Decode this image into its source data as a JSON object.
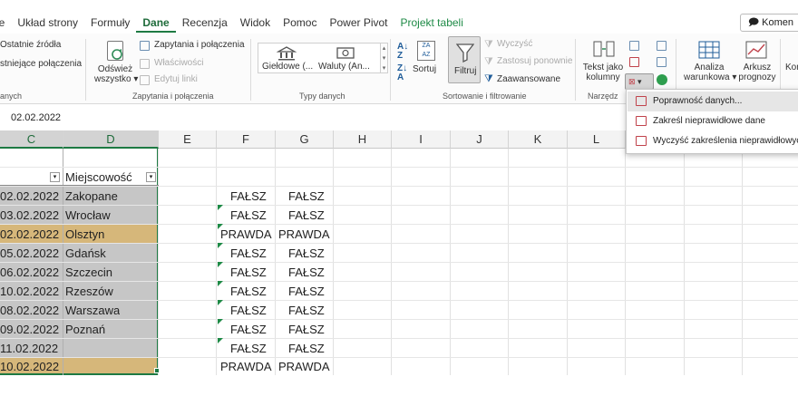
{
  "menu": {
    "tabs": [
      "ie",
      "Układ strony",
      "Formuły",
      "Dane",
      "Recenzja",
      "Widok",
      "Pomoc",
      "Power Pivot",
      "Projekt tabeli"
    ],
    "active": "Dane",
    "comments": "Komen"
  },
  "ribbon": {
    "left": {
      "recent_sources": "Ostatnie źródła",
      "existing_connections": "stniejące połączenia",
      "group_label": "anych"
    },
    "queries": {
      "refresh_all_line1": "Odśwież",
      "refresh_all_line2": "wszystko",
      "queries_connections": "Zapytania i połączenia",
      "properties": "Właściwości",
      "edit_links": "Edytuj linki",
      "group_label": "Zapytania i połączenia"
    },
    "data_types": {
      "stocks": "Giełdowe (...",
      "currencies": "Waluty (An...",
      "group_label": "Typy danych"
    },
    "sort_filter": {
      "sort": "Sortuj",
      "filter": "Filtruj",
      "clear": "Wyczyść",
      "reapply": "Zastosuj ponownie",
      "advanced": "Zaawansowane",
      "group_label": "Sortowanie i filtrowanie"
    },
    "tools": {
      "text_to_columns_line1": "Tekst jako",
      "text_to_columns_line2": "kolumny",
      "group_label": "Narzędz"
    },
    "forecast": {
      "whatif_line1": "Analiza",
      "whatif_line2": "warunkowa",
      "sheet_line1": "Arkusz",
      "sheet_line2": "prognozy",
      "outline": "Kon"
    }
  },
  "formula_bar": {
    "value": "02.02.2022"
  },
  "columns": [
    "C",
    "D",
    "E",
    "F",
    "G",
    "H",
    "I",
    "J",
    "K",
    "L"
  ],
  "table": {
    "header_d": "Miejscowość",
    "rows": [
      {
        "c": "02.02.2022",
        "d": "Zakopane",
        "f": "FAŁSZ",
        "g": "FAŁSZ"
      },
      {
        "c": "03.02.2022",
        "d": "Wrocław",
        "f": "FAŁSZ",
        "g": "FAŁSZ"
      },
      {
        "c": "02.02.2022",
        "d": "Olsztyn",
        "f": "PRAWDA",
        "g": "PRAWDA"
      },
      {
        "c": "05.02.2022",
        "d": "Gdańsk",
        "f": "FAŁSZ",
        "g": "FAŁSZ"
      },
      {
        "c": "06.02.2022",
        "d": "Szczecin",
        "f": "FAŁSZ",
        "g": "FAŁSZ"
      },
      {
        "c": "10.02.2022",
        "d": "Rzeszów",
        "f": "FAŁSZ",
        "g": "FAŁSZ"
      },
      {
        "c": "08.02.2022",
        "d": "Warszawa",
        "f": "FAŁSZ",
        "g": "FAŁSZ"
      },
      {
        "c": "09.02.2022",
        "d": "Poznań",
        "f": "FAŁSZ",
        "g": "FAŁSZ"
      },
      {
        "c": "11.02.2022",
        "d": "",
        "f": "FAŁSZ",
        "g": "FAŁSZ"
      },
      {
        "c": "10.02.2022",
        "d": "",
        "f": "PRAWDA",
        "g": "PRAWDA"
      }
    ]
  },
  "dropdown": {
    "items": [
      "Poprawność danych...",
      "Zakreśl nieprawidłowe dane",
      "Wyczyść zakreślenia nieprawidłowych d"
    ]
  },
  "colors": {
    "accent": "#1e7a43",
    "highlight": "#d6b77a",
    "selection": "#c6c6c6"
  }
}
